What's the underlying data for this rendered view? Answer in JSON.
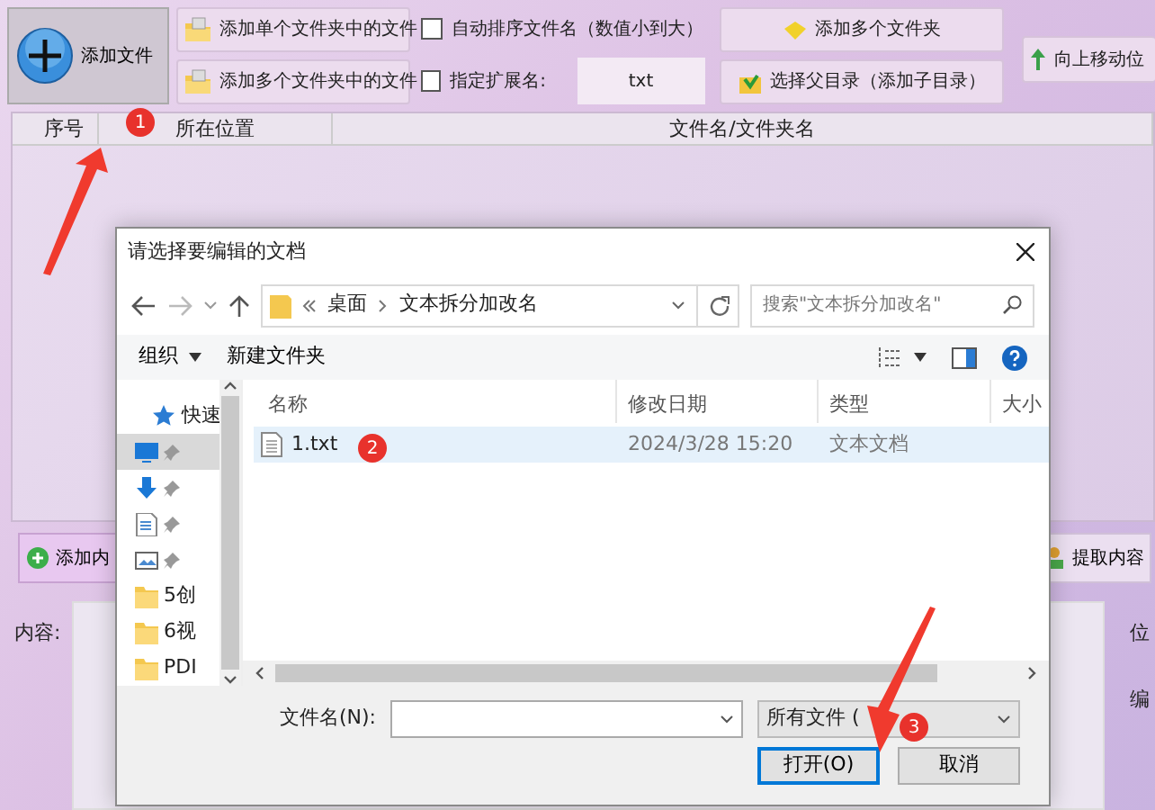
{
  "toolbar": {
    "add_file": {
      "label": "添加文件"
    },
    "file_buttons": [
      {
        "label": "添加单个文件夹中的文件"
      },
      {
        "label": "添加多个文件夹中的文件"
      }
    ],
    "options": [
      {
        "kind": "checkbox",
        "label": "自动排序文件名（数值小到大）",
        "checked": false
      },
      {
        "kind": "extension",
        "label": "指定扩展名:",
        "checked": false,
        "value": "txt"
      }
    ],
    "folder_buttons": [
      {
        "kind": "folder",
        "label": "添加多个文件夹"
      },
      {
        "kind": "parent",
        "label": "选择父目录（添加子目录）"
      }
    ],
    "move_up": {
      "label": "向上移动位"
    }
  },
  "table": {
    "columns": [
      "序号",
      "所在位置",
      "文件名/文件夹名"
    ]
  },
  "lower": {
    "add_content": "添加内",
    "extract": "提取内容",
    "content_label": "内容:",
    "side_labels": [
      "位",
      "编"
    ]
  },
  "dialog": {
    "title": "请选择要编辑的文档",
    "breadcrumb": [
      "桌面",
      "文本拆分加改名"
    ],
    "search_placeholder": "搜索\"文本拆分加改名\"",
    "commands": [
      {
        "label": "组织",
        "menu": true
      },
      {
        "label": "新建文件夹",
        "menu": false
      }
    ],
    "sidebar": [
      {
        "kind": "header",
        "label": "快速"
      },
      {
        "kind": "desktop",
        "selected": true,
        "pinned": true
      },
      {
        "kind": "download",
        "selected": false,
        "pinned": true
      },
      {
        "kind": "document",
        "selected": false,
        "pinned": true
      },
      {
        "kind": "image",
        "selected": false,
        "pinned": true
      },
      {
        "kind": "folder",
        "label": "5创",
        "selected": false,
        "pinned": false
      },
      {
        "kind": "folder",
        "label": "6视",
        "selected": false,
        "pinned": false
      },
      {
        "kind": "folder",
        "label": "PDI",
        "selected": false,
        "pinned": false
      }
    ],
    "columns": [
      "名称",
      "修改日期",
      "类型",
      "大小"
    ],
    "files": [
      {
        "name": "1.txt",
        "modified": "2024/3/28 15:20",
        "type": "文本文档",
        "selected": true
      }
    ],
    "filename_label": "文件名(N):",
    "filter": "所有文件 (",
    "buttons": [
      {
        "label": "打开(O)",
        "primary": true
      },
      {
        "label": "取消",
        "primary": false
      }
    ]
  },
  "annotations": [
    {
      "label": "1"
    },
    {
      "label": "2"
    },
    {
      "label": "3"
    }
  ]
}
